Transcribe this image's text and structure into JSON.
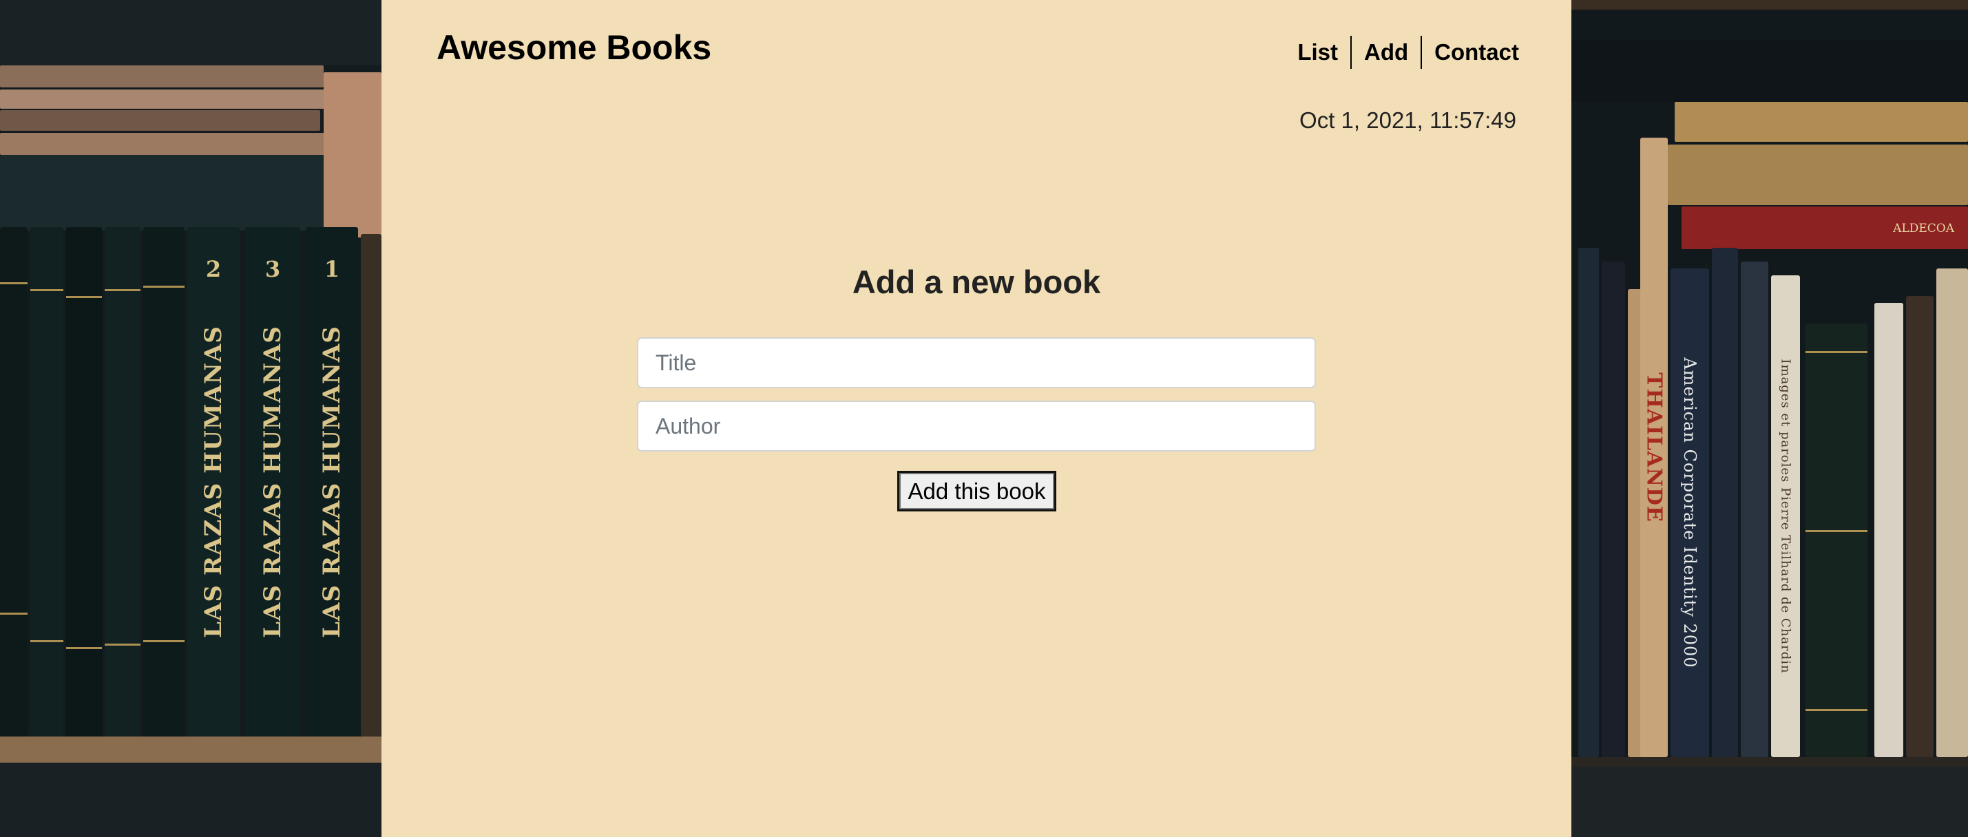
{
  "header": {
    "brand": "Awesome Books",
    "nav": [
      {
        "label": "List"
      },
      {
        "label": "Add"
      },
      {
        "label": "Contact"
      }
    ],
    "datetime": "Oct 1, 2021, 11:57:49"
  },
  "form": {
    "heading": "Add a new book",
    "title_placeholder": "Title",
    "author_placeholder": "Author",
    "submit_label": "Add this book"
  },
  "background": {
    "left_spines": [
      {
        "text": "LAS RAZAS HUMANAS",
        "volume": "2"
      },
      {
        "text": "LAS RAZAS HUMANAS",
        "volume": "3"
      },
      {
        "text": "LAS RAZAS HUMANAS",
        "volume": "1"
      }
    ],
    "right_spines": [
      {
        "text": "THAILANDE"
      },
      {
        "text": "American Corporate Identity 2000"
      },
      {
        "text": "Images et paroles Pierre Teilhard de Chardin"
      }
    ],
    "right_top_book": "ALDECOA"
  },
  "colors": {
    "panel": "#f2dfb7",
    "text": "#222222",
    "shelf_dark": "#141b1e"
  }
}
